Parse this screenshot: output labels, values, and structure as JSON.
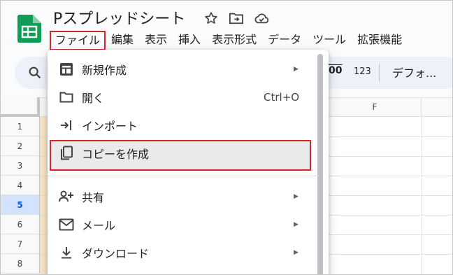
{
  "app": {
    "doc_title": "Pスプレッドシート"
  },
  "menubar": {
    "items": [
      "ファイル",
      "編集",
      "表示",
      "挿入",
      "表示形式",
      "データ",
      "ツール",
      "拡張機能"
    ]
  },
  "toolbar": {
    "zeros_label": "00",
    "number_format_label": "123",
    "font_label": "デフォ..."
  },
  "grid": {
    "column_header": "F",
    "rows": [
      "1",
      "2",
      "3",
      "4",
      "5",
      "6",
      "7",
      "8"
    ],
    "selected_row": "5"
  },
  "file_menu": {
    "items": [
      {
        "label": "新規作成",
        "icon": "add-box-icon",
        "submenu": true
      },
      {
        "label": "開く",
        "icon": "folder-icon",
        "shortcut": "Ctrl+O"
      },
      {
        "label": "インポート",
        "icon": "import-icon"
      },
      {
        "label": "コピーを作成",
        "icon": "copy-icon",
        "highlighted": true
      },
      {
        "label": "共有",
        "icon": "person-add-icon",
        "submenu": true
      },
      {
        "label": "メール",
        "icon": "mail-icon",
        "submenu": true
      },
      {
        "label": "ダウンロード",
        "icon": "download-icon",
        "submenu": true
      }
    ],
    "submenu_glyph": "▶"
  },
  "colors": {
    "highlight_red": "#d8232a",
    "sheets_green": "#0f9d58",
    "selected_row_bg": "#d3e3fd"
  }
}
